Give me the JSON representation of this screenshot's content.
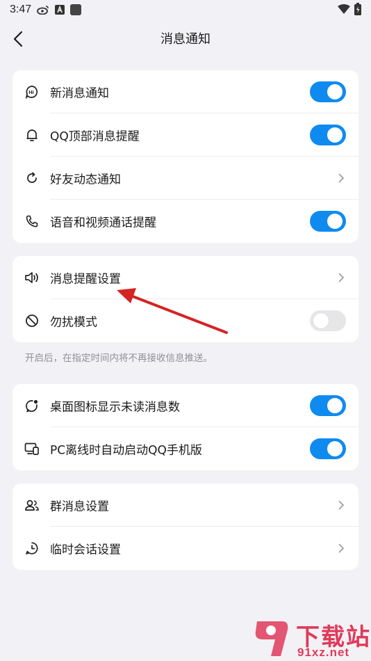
{
  "status_bar": {
    "time": "3:47"
  },
  "header": {
    "title": "消息通知"
  },
  "group1": [
    {
      "label": "新消息通知",
      "icon": "hi-bubble-icon",
      "control": "toggle",
      "on": true
    },
    {
      "label": "QQ顶部消息提醒",
      "icon": "bell-icon",
      "control": "toggle",
      "on": true
    },
    {
      "label": "好友动态通知",
      "icon": "refresh-icon",
      "control": "chevron"
    },
    {
      "label": "语音和视频通话提醒",
      "icon": "phone-icon",
      "control": "toggle",
      "on": true
    }
  ],
  "group2": [
    {
      "label": "消息提醒设置",
      "icon": "speaker-icon",
      "control": "chevron"
    },
    {
      "label": "勿扰模式",
      "icon": "do-not-disturb-icon",
      "control": "toggle",
      "on": false
    }
  ],
  "group2_hint": "开启后，在指定时间内将不再接收信息推送。",
  "group3": [
    {
      "label": "桌面图标显示未读消息数",
      "icon": "badge-bubble-icon",
      "control": "toggle",
      "on": true
    },
    {
      "label": "PC离线时自动启动QQ手机版",
      "icon": "pc-phone-icon",
      "control": "toggle",
      "on": true
    }
  ],
  "group4": [
    {
      "label": "群消息设置",
      "icon": "group-icon",
      "control": "chevron"
    },
    {
      "label": "临时会话设置",
      "icon": "clock-icon",
      "control": "chevron"
    }
  ],
  "colors": {
    "accent": "#0f8bf0",
    "arrow": "#d42424",
    "watermark": "#e03a5a"
  },
  "watermark": {
    "top": "下载站",
    "bottom": "91xz.net"
  }
}
